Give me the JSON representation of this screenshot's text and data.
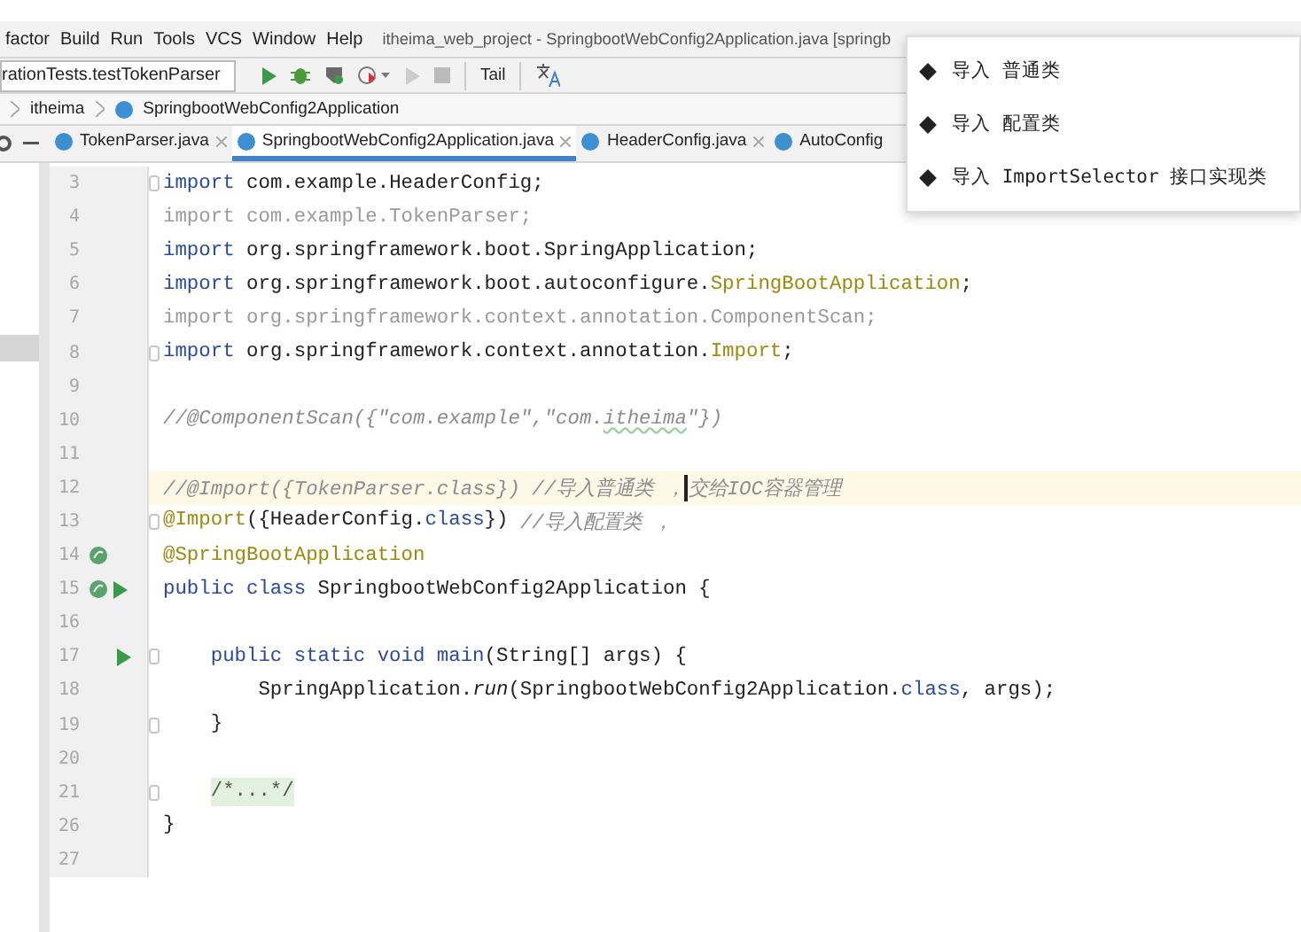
{
  "menu": [
    "factor",
    "Build",
    "Run",
    "Tools",
    "VCS",
    "Window",
    "Help"
  ],
  "window": {
    "title": "itheima_web_project - SpringbootWebConfig2Application.java [springb"
  },
  "toolbar": {
    "run_config": "rationTests.testTokenParser",
    "tail": "Tail"
  },
  "breadcrumb": [
    "itheima",
    "SpringbootWebConfig2Application"
  ],
  "tabs": [
    {
      "label": "TokenParser.java",
      "selected": false
    },
    {
      "label": "SpringbootWebConfig2Application.java",
      "selected": true
    },
    {
      "label": "HeaderConfig.java",
      "selected": false
    },
    {
      "label": "AutoConfig",
      "selected": false
    }
  ],
  "editor": {
    "lines": [
      {
        "number": "3",
        "kind": "plain",
        "fold": true,
        "current": false,
        "tokens": [
          {
            "kind": "keyword",
            "text": "import"
          },
          {
            "kind": "plain",
            "text": " com.example.HeaderConfig;"
          }
        ]
      },
      {
        "number": "4",
        "kind": "plain",
        "fold": false,
        "current": false,
        "tokens": [
          {
            "kind": "unused",
            "text": "import com.example.TokenParser;"
          }
        ]
      },
      {
        "number": "5",
        "kind": "plain",
        "fold": false,
        "current": false,
        "tokens": [
          {
            "kind": "keyword",
            "text": "import"
          },
          {
            "kind": "plain",
            "text": " org.springframework.boot.SpringApplication;"
          }
        ]
      },
      {
        "number": "6",
        "kind": "plain",
        "fold": false,
        "current": false,
        "tokens": [
          {
            "kind": "keyword",
            "text": "import"
          },
          {
            "kind": "plain",
            "text": " org.springframework.boot.autoconfigure."
          },
          {
            "kind": "annotation",
            "text": "SpringBootApplication"
          },
          {
            "kind": "plain",
            "text": ";"
          }
        ]
      },
      {
        "number": "7",
        "kind": "plain",
        "fold": false,
        "current": false,
        "tokens": [
          {
            "kind": "unused",
            "text": "import org.springframework.context.annotation.ComponentScan;"
          }
        ]
      },
      {
        "number": "8",
        "kind": "plain",
        "fold": true,
        "current": false,
        "tokens": [
          {
            "kind": "keyword",
            "text": "import"
          },
          {
            "kind": "plain",
            "text": " org.springframework.context.annotation."
          },
          {
            "kind": "annotation",
            "text": "Import"
          },
          {
            "kind": "plain",
            "text": ";"
          }
        ]
      },
      {
        "number": "9",
        "kind": "plain",
        "fold": false,
        "current": false
      },
      {
        "number": "10",
        "kind": "plain",
        "fold": false,
        "current": false,
        "tokens": [
          {
            "kind": "comment",
            "text": "//@ComponentScan({\"com.example\",\"com."
          },
          {
            "kind": "typo",
            "text": "itheima"
          },
          {
            "kind": "comment",
            "text": "\"})"
          }
        ]
      },
      {
        "number": "11",
        "kind": "plain",
        "fold": false,
        "current": false
      },
      {
        "number": "12",
        "kind": "plain",
        "fold": false,
        "current": true,
        "tokens": [
          {
            "kind": "comment",
            "text": "//@Import({TokenParser.class}) //导入普通类 ，"
          },
          {
            "kind": "comment",
            "text": "交给IOC容器管理",
            "caret": true
          }
        ]
      },
      {
        "number": "13",
        "kind": "plain",
        "fold": true,
        "current": false,
        "tokens": [
          {
            "kind": "annotation",
            "text": "@Import"
          },
          {
            "kind": "plain",
            "text": "({HeaderConfig."
          },
          {
            "kind": "keyword",
            "text": "class"
          },
          {
            "kind": "plain",
            "text": "}) "
          },
          {
            "kind": "comment",
            "text": "//导入配置类 ，"
          }
        ]
      },
      {
        "number": "14",
        "kind": "bean",
        "fold": false,
        "current": false,
        "tokens": [
          {
            "kind": "annotation",
            "text": "@SpringBootApplication"
          }
        ]
      },
      {
        "number": "15",
        "kind": "bean-run",
        "fold": false,
        "current": false,
        "tokens": [
          {
            "kind": "keyword",
            "text": "public class"
          },
          {
            "kind": "plain",
            "text": " SpringbootWebConfig2Application {"
          }
        ]
      },
      {
        "number": "16",
        "kind": "plain",
        "fold": false,
        "current": false
      },
      {
        "number": "17",
        "kind": "run",
        "fold": true,
        "current": false,
        "tokens": [
          {
            "kind": "keyword",
            "text": "    public static void main"
          },
          {
            "kind": "plain",
            "text": "(String[] args) {"
          }
        ]
      },
      {
        "number": "18",
        "kind": "plain",
        "fold": false,
        "current": false,
        "tokens": [
          {
            "kind": "plain",
            "text": "        SpringApplication."
          },
          {
            "kind": "italic",
            "text": "run"
          },
          {
            "kind": "plain",
            "text": "(SpringbootWebConfig2Application."
          },
          {
            "kind": "keyword",
            "text": "class"
          },
          {
            "kind": "plain",
            "text": ", args);"
          }
        ]
      },
      {
        "number": "19",
        "kind": "plain",
        "fold": true,
        "current": false,
        "tokens": [
          {
            "kind": "plain",
            "text": "    }"
          }
        ]
      },
      {
        "number": "20",
        "kind": "plain",
        "fold": false,
        "current": false
      },
      {
        "number": "21",
        "kind": "plain",
        "fold": true,
        "current": false,
        "tokens": [
          {
            "kind": "folded",
            "text": "    /*...*/"
          }
        ]
      },
      {
        "number": "26",
        "kind": "plain",
        "fold": false,
        "current": false,
        "tokens": [
          {
            "kind": "plain",
            "text": "}"
          }
        ]
      },
      {
        "number": "27",
        "kind": "plain",
        "fold": false,
        "current": false
      }
    ]
  },
  "popup": {
    "items": [
      "导入 普通类",
      "导入 配置类",
      "导入 ImportSelector 接口实现类"
    ]
  }
}
